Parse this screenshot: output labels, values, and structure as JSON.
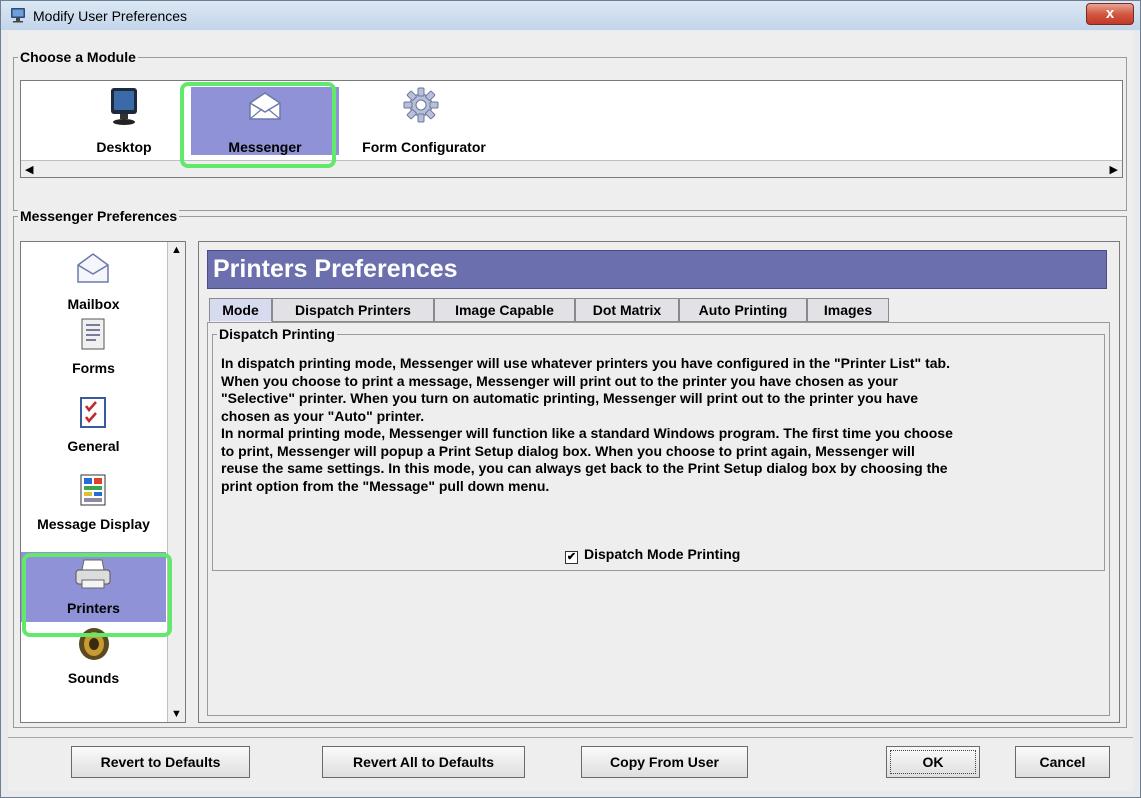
{
  "window": {
    "title": "Modify User Preferences",
    "close_label": "x"
  },
  "modules": {
    "group_label": "Choose a Module",
    "items": [
      {
        "label": "Desktop",
        "icon": "monitor-icon"
      },
      {
        "label": "Messenger",
        "icon": "envelope-icon",
        "selected": true
      },
      {
        "label": "Form Configurator",
        "icon": "gear-icon"
      }
    ]
  },
  "preferences": {
    "group_label": "Messenger Preferences",
    "sidebar": [
      {
        "label": "Mailbox",
        "icon": "envelope-icon"
      },
      {
        "label": "Forms",
        "icon": "form-document-icon"
      },
      {
        "label": "General",
        "icon": "checklist-icon"
      },
      {
        "label": "Message Display",
        "icon": "message-display-icon"
      },
      {
        "label": "Printers",
        "icon": "printer-icon",
        "selected": true
      },
      {
        "label": "Sounds",
        "icon": "speaker-icon"
      }
    ],
    "header": "Printers Preferences",
    "tabs": [
      "Mode",
      "Dispatch Printers",
      "Image Capable",
      "Dot Matrix",
      "Auto Printing",
      "Images"
    ],
    "active_tab": "Mode",
    "section_label": "Dispatch Printing",
    "description_lines": [
      "In dispatch printing mode, Messenger will use whatever printers you have configured in the \"Printer List\" tab.",
      "When you choose to print a message, Messenger will print out to the printer you have chosen as your",
      "\"Selective\" printer.  When you turn on automatic printing, Messenger will print out to the printer you have",
      "chosen as your \"Auto\" printer.",
      "In normal printing mode, Messenger will function like a standard Windows program.  The first time you choose",
      "to print, Messenger will popup a Print Setup dialog box.  When you choose to print again, Messenger will",
      "reuse the same settings.  In this mode, you can always get back to the Print Setup dialog box by choosing the",
      "print option from the \"Message\" pull down menu."
    ],
    "checkbox": {
      "label": "Dispatch Mode Printing",
      "checked": true,
      "mark": "✔"
    }
  },
  "buttons": {
    "revert": "Revert to Defaults",
    "revert_all": "Revert All to Defaults",
    "copy": "Copy From User",
    "ok": "OK",
    "cancel": "Cancel"
  },
  "colors": {
    "selection": "#8f92d6",
    "header": "#6b6fae",
    "highlight": "#62e86a"
  }
}
